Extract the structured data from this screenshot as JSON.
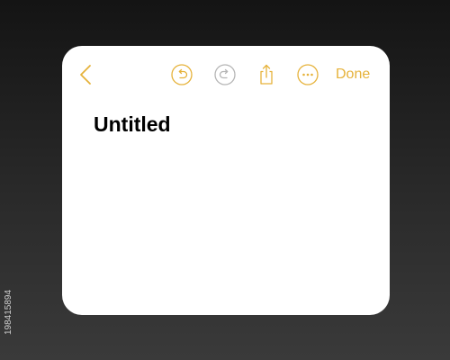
{
  "colors": {
    "accent": "#e6b23a",
    "disabled_icon": "#b5b5b5",
    "card_background": "#ffffff"
  },
  "toolbar": {
    "back_icon": "chevron-left-icon",
    "undo_icon": "undo-icon",
    "redo_icon": "redo-icon",
    "share_icon": "share-icon",
    "more_icon": "more-icon",
    "done_label": "Done"
  },
  "note": {
    "title": "Untitled"
  },
  "watermark": {
    "stock_id": "198415894"
  }
}
